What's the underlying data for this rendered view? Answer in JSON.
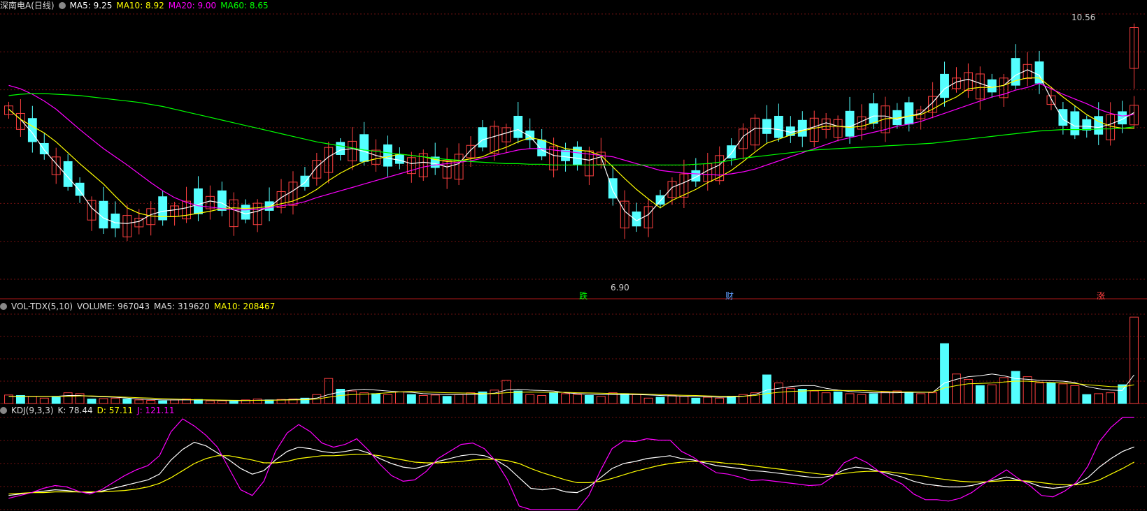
{
  "colors": {
    "bg": "#000000",
    "up": "#ff4040",
    "down": "#54ffff",
    "ma5": "#ffffff",
    "ma10": "#ffff00",
    "ma20": "#ff00ff",
    "ma60": "#00ff00",
    "grid": "#6e1010"
  },
  "header_main": {
    "name": "深南电A(日线)",
    "ma5": "MA5: 9.25",
    "ma10": "MA10: 8.92",
    "ma20": "MA20: 9.00",
    "ma60": "MA60: 8.65"
  },
  "header_vol": {
    "name": "VOL-TDX(5,10)",
    "volume": "VOLUME: 967043",
    "ma5": "MA5: 319620",
    "ma10": "MA10: 208467"
  },
  "header_kdj": {
    "name": "KDJ(9,3,3)",
    "k": "K: 78.44",
    "d": "D: 57.11",
    "j": "J: 121.11"
  },
  "annotations": {
    "high": "10.56",
    "low": "6.90",
    "mark_down": "跌",
    "mark_cai": "财",
    "mark_up": "涨"
  },
  "chart_data": [
    {
      "type": "candlestick",
      "title": "深南电A(日线)",
      "ylim": [
        6.8,
        10.7
      ],
      "series": [
        {
          "name": "MA5",
          "values": [
            9.3,
            9.15,
            8.95,
            8.7,
            8.5,
            8.3,
            8.1,
            7.85,
            7.7,
            7.63,
            7.62,
            7.65,
            7.75,
            7.8,
            7.82,
            7.85,
            7.9,
            7.95,
            7.92,
            7.82,
            7.76,
            7.8,
            7.86,
            8.0,
            8.1,
            8.22,
            8.45,
            8.6,
            8.7,
            8.72,
            8.68,
            8.62,
            8.58,
            8.55,
            8.5,
            8.52,
            8.5,
            8.45,
            8.5,
            8.7,
            8.85,
            8.9,
            8.95,
            9.0,
            8.9,
            8.7,
            8.62,
            8.6,
            8.58,
            8.55,
            8.6,
            8.1,
            7.8,
            7.66,
            7.75,
            7.95,
            8.15,
            8.22,
            8.3,
            8.4,
            8.48,
            8.65,
            8.9,
            9.02,
            9.02,
            9.0,
            8.96,
            8.99,
            9.04,
            9.1,
            9.05,
            9.04,
            9.12,
            9.2,
            9.2,
            9.15,
            9.2,
            9.24,
            9.4,
            9.6,
            9.7,
            9.74,
            9.68,
            9.62,
            9.65,
            9.8,
            9.88,
            9.8,
            9.45,
            9.15,
            9.05,
            9.05,
            9.03,
            9.08,
            9.15,
            9.25
          ]
        },
        {
          "name": "MA10",
          "values": [
            9.3,
            9.15,
            9.05,
            8.95,
            8.82,
            8.66,
            8.5,
            8.35,
            8.2,
            8.02,
            7.85,
            7.77,
            7.73,
            7.72,
            7.72,
            7.74,
            7.77,
            7.8,
            7.84,
            7.85,
            7.84,
            7.85,
            7.87,
            7.91,
            7.95,
            8.02,
            8.12,
            8.25,
            8.36,
            8.45,
            8.53,
            8.57,
            8.6,
            8.64,
            8.62,
            8.6,
            8.56,
            8.53,
            8.54,
            8.57,
            8.6,
            8.68,
            8.74,
            8.82,
            8.88,
            8.85,
            8.78,
            8.72,
            8.7,
            8.68,
            8.62,
            8.45,
            8.28,
            8.12,
            7.98,
            7.85,
            7.96,
            8.04,
            8.12,
            8.22,
            8.3,
            8.4,
            8.53,
            8.67,
            8.8,
            8.86,
            8.92,
            8.98,
            9.02,
            9.05,
            9.05,
            9.03,
            9.05,
            9.1,
            9.16,
            9.17,
            9.2,
            9.22,
            9.3,
            9.4,
            9.48,
            9.6,
            9.62,
            9.62,
            9.65,
            9.72,
            9.76,
            9.76,
            9.62,
            9.48,
            9.35,
            9.22,
            9.12,
            9.05,
            9.02,
            9.02
          ]
        },
        {
          "name": "MA20",
          "values": [
            9.65,
            9.6,
            9.52,
            9.42,
            9.3,
            9.15,
            9.0,
            8.86,
            8.72,
            8.6,
            8.48,
            8.35,
            8.22,
            8.1,
            8.0,
            7.93,
            7.88,
            7.86,
            7.84,
            7.82,
            7.82,
            7.83,
            7.85,
            7.88,
            7.9,
            7.94,
            8.0,
            8.05,
            8.1,
            8.15,
            8.2,
            8.25,
            8.3,
            8.35,
            8.4,
            8.45,
            8.48,
            8.5,
            8.52,
            8.54,
            8.58,
            8.62,
            8.66,
            8.7,
            8.72,
            8.72,
            8.7,
            8.68,
            8.66,
            8.64,
            8.62,
            8.6,
            8.55,
            8.5,
            8.45,
            8.4,
            8.38,
            8.36,
            8.35,
            8.34,
            8.33,
            8.35,
            8.38,
            8.42,
            8.48,
            8.54,
            8.6,
            8.66,
            8.72,
            8.78,
            8.84,
            8.88,
            8.92,
            8.96,
            9.0,
            9.05,
            9.08,
            9.12,
            9.18,
            9.24,
            9.3,
            9.36,
            9.42,
            9.48,
            9.52,
            9.58,
            9.62,
            9.68,
            9.6,
            9.52,
            9.45,
            9.38,
            9.3,
            9.24,
            9.2,
            9.22
          ]
        },
        {
          "name": "MA60",
          "values": [
            9.5,
            9.52,
            9.53,
            9.53,
            9.52,
            9.51,
            9.5,
            9.48,
            9.46,
            9.44,
            9.42,
            9.4,
            9.37,
            9.34,
            9.3,
            9.26,
            9.22,
            9.18,
            9.14,
            9.1,
            9.06,
            9.02,
            8.98,
            8.94,
            8.9,
            8.86,
            8.82,
            8.79,
            8.76,
            8.73,
            8.7,
            8.68,
            8.66,
            8.64,
            8.62,
            8.6,
            8.58,
            8.56,
            8.55,
            8.53,
            8.52,
            8.51,
            8.5,
            8.5,
            8.49,
            8.49,
            8.48,
            8.48,
            8.48,
            8.48,
            8.48,
            8.48,
            8.48,
            8.48,
            8.48,
            8.48,
            8.48,
            8.48,
            8.49,
            8.5,
            8.52,
            8.55,
            8.58,
            8.6,
            8.62,
            8.64,
            8.66,
            8.68,
            8.7,
            8.71,
            8.72,
            8.73,
            8.74,
            8.75,
            8.76,
            8.77,
            8.78,
            8.79,
            8.8,
            8.82,
            8.84,
            8.86,
            8.88,
            8.9,
            8.92,
            8.94,
            8.96,
            8.98,
            8.99,
            9.0,
            9.0,
            9.0,
            9.01,
            9.01,
            9.02,
            9.04
          ]
        }
      ]
    },
    {
      "type": "bar",
      "title": "VOL-TDX(5,10)",
      "ylim": [
        0,
        1000000
      ],
      "values": [
        95000,
        90000,
        80000,
        60000,
        70000,
        120000,
        110000,
        50000,
        55000,
        60000,
        50000,
        40000,
        35000,
        30000,
        40000,
        50000,
        45000,
        30000,
        30000,
        25000,
        40000,
        50000,
        40000,
        45000,
        50000,
        60000,
        100000,
        280000,
        160000,
        140000,
        120000,
        110000,
        100000,
        130000,
        100000,
        90000,
        95000,
        80000,
        100000,
        120000,
        130000,
        150000,
        260000,
        140000,
        100000,
        90000,
        120000,
        110000,
        100000,
        90000,
        80000,
        120000,
        110000,
        100000,
        60000,
        70000,
        90000,
        80000,
        60000,
        70000,
        60000,
        80000,
        100000,
        120000,
        320000,
        230000,
        170000,
        160000,
        140000,
        120000,
        130000,
        110000,
        100000,
        110000,
        130000,
        140000,
        120000,
        110000,
        120000,
        670000,
        330000,
        270000,
        200000,
        210000,
        290000,
        360000,
        300000,
        230000,
        230000,
        220000,
        200000,
        100000,
        110000,
        120000,
        210000,
        967043
      ],
      "series": [
        {
          "name": "MA5",
          "values": [
            80000,
            80000,
            80000,
            80000,
            80000,
            90000,
            90000,
            80000,
            75000,
            70000,
            60000,
            50000,
            45000,
            40000,
            40000,
            40000,
            40000,
            38000,
            35000,
            32000,
            32000,
            36000,
            38000,
            40000,
            45000,
            50000,
            60000,
            100000,
            130000,
            150000,
            160000,
            150000,
            140000,
            130000,
            125000,
            110000,
            105000,
            100000,
            100000,
            100000,
            105000,
            115000,
            150000,
            160000,
            150000,
            145000,
            140000,
            120000,
            110000,
            105000,
            100000,
            100000,
            100000,
            100000,
            95000,
            90000,
            85000,
            82000,
            80000,
            75000,
            70000,
            72000,
            80000,
            100000,
            150000,
            170000,
            190000,
            200000,
            200000,
            170000,
            150000,
            135000,
            125000,
            120000,
            120000,
            120000,
            125000,
            125000,
            125000,
            230000,
            270000,
            300000,
            310000,
            330000,
            310000,
            280000,
            270000,
            260000,
            255000,
            250000,
            235000,
            190000,
            165000,
            150000,
            145000,
            319620
          ]
        },
        {
          "name": "MA10",
          "values": [
            80000,
            80000,
            80000,
            80000,
            80000,
            80000,
            85000,
            85000,
            80000,
            75000,
            70000,
            65000,
            60000,
            55000,
            50000,
            45000,
            42000,
            40000,
            38000,
            36000,
            35000,
            35000,
            36000,
            38000,
            40000,
            42000,
            50000,
            70000,
            90000,
            100000,
            105000,
            110000,
            120000,
            130000,
            135000,
            130000,
            125000,
            120000,
            118000,
            115000,
            110000,
            110000,
            120000,
            125000,
            128000,
            126000,
            125000,
            125000,
            120000,
            118000,
            115000,
            112000,
            110000,
            108000,
            105000,
            100000,
            95000,
            92000,
            90000,
            85000,
            82000,
            80000,
            82000,
            90000,
            110000,
            125000,
            135000,
            140000,
            145000,
            145000,
            145000,
            145000,
            145000,
            140000,
            135000,
            130000,
            130000,
            128000,
            127000,
            175000,
            200000,
            220000,
            225000,
            230000,
            240000,
            250000,
            250000,
            240000,
            235000,
            230000,
            225000,
            210000,
            200000,
            190000,
            185000,
            208467
          ]
        }
      ]
    },
    {
      "type": "line",
      "title": "KDJ(9,3,3)",
      "ylim": [
        -10,
        120
      ],
      "series": [
        {
          "name": "K",
          "values": [
            10,
            12,
            14,
            16,
            18,
            17,
            15,
            14,
            16,
            20,
            24,
            28,
            32,
            40,
            60,
            75,
            85,
            80,
            70,
            60,
            48,
            40,
            45,
            60,
            72,
            78,
            76,
            72,
            70,
            72,
            75,
            70,
            62,
            55,
            50,
            48,
            52,
            58,
            62,
            66,
            68,
            66,
            60,
            50,
            35,
            20,
            18,
            20,
            15,
            14,
            22,
            35,
            48,
            55,
            58,
            62,
            64,
            66,
            62,
            60,
            56,
            52,
            50,
            48,
            45,
            44,
            42,
            40,
            38,
            36,
            35,
            38,
            46,
            50,
            48,
            44,
            40,
            36,
            30,
            26,
            24,
            22,
            22,
            24,
            28,
            32,
            36,
            32,
            28,
            22,
            20,
            22,
            26,
            35,
            50,
            62,
            72,
            78.44
          ]
        },
        {
          "name": "D",
          "values": [
            12,
            13,
            14,
            14,
            15,
            15,
            15,
            15,
            15,
            16,
            17,
            19,
            22,
            27,
            35,
            45,
            55,
            62,
            66,
            66,
            63,
            60,
            56,
            56,
            58,
            62,
            64,
            66,
            66,
            67,
            68,
            68,
            66,
            63,
            60,
            57,
            56,
            56,
            57,
            58,
            60,
            61,
            61,
            59,
            55,
            48,
            42,
            37,
            32,
            28,
            28,
            30,
            34,
            39,
            44,
            48,
            52,
            55,
            57,
            58,
            58,
            57,
            55,
            54,
            52,
            50,
            48,
            46,
            44,
            42,
            40,
            39,
            41,
            43,
            44,
            44,
            43,
            41,
            39,
            37,
            34,
            32,
            30,
            29,
            29,
            30,
            31,
            31,
            30,
            28,
            26,
            25,
            25,
            27,
            32,
            40,
            48,
            57.11
          ]
        },
        {
          "name": "J",
          "values": [
            6,
            10,
            14,
            20,
            24,
            22,
            16,
            12,
            18,
            28,
            38,
            46,
            52,
            66,
            100,
            118,
            108,
            95,
            78,
            48,
            18,
            10,
            30,
            72,
            98,
            110,
            100,
            84,
            78,
            82,
            90,
            74,
            54,
            38,
            30,
            32,
            44,
            62,
            72,
            82,
            84,
            76,
            58,
            32,
            -5,
            -30,
            -25,
            -12,
            -19,
            -14,
            10,
            45,
            76,
            87,
            86,
            90,
            88,
            88,
            72,
            64,
            52,
            42,
            40,
            36,
            31,
            32,
            30,
            28,
            26,
            24,
            25,
            36,
            56,
            64,
            56,
            44,
            34,
            26,
            12,
            4,
            4,
            2,
            6,
            14,
            26,
            36,
            46,
            34,
            24,
            10,
            8,
            16,
            28,
            51,
            86,
            106,
            120,
            121.11
          ]
        }
      ]
    }
  ]
}
